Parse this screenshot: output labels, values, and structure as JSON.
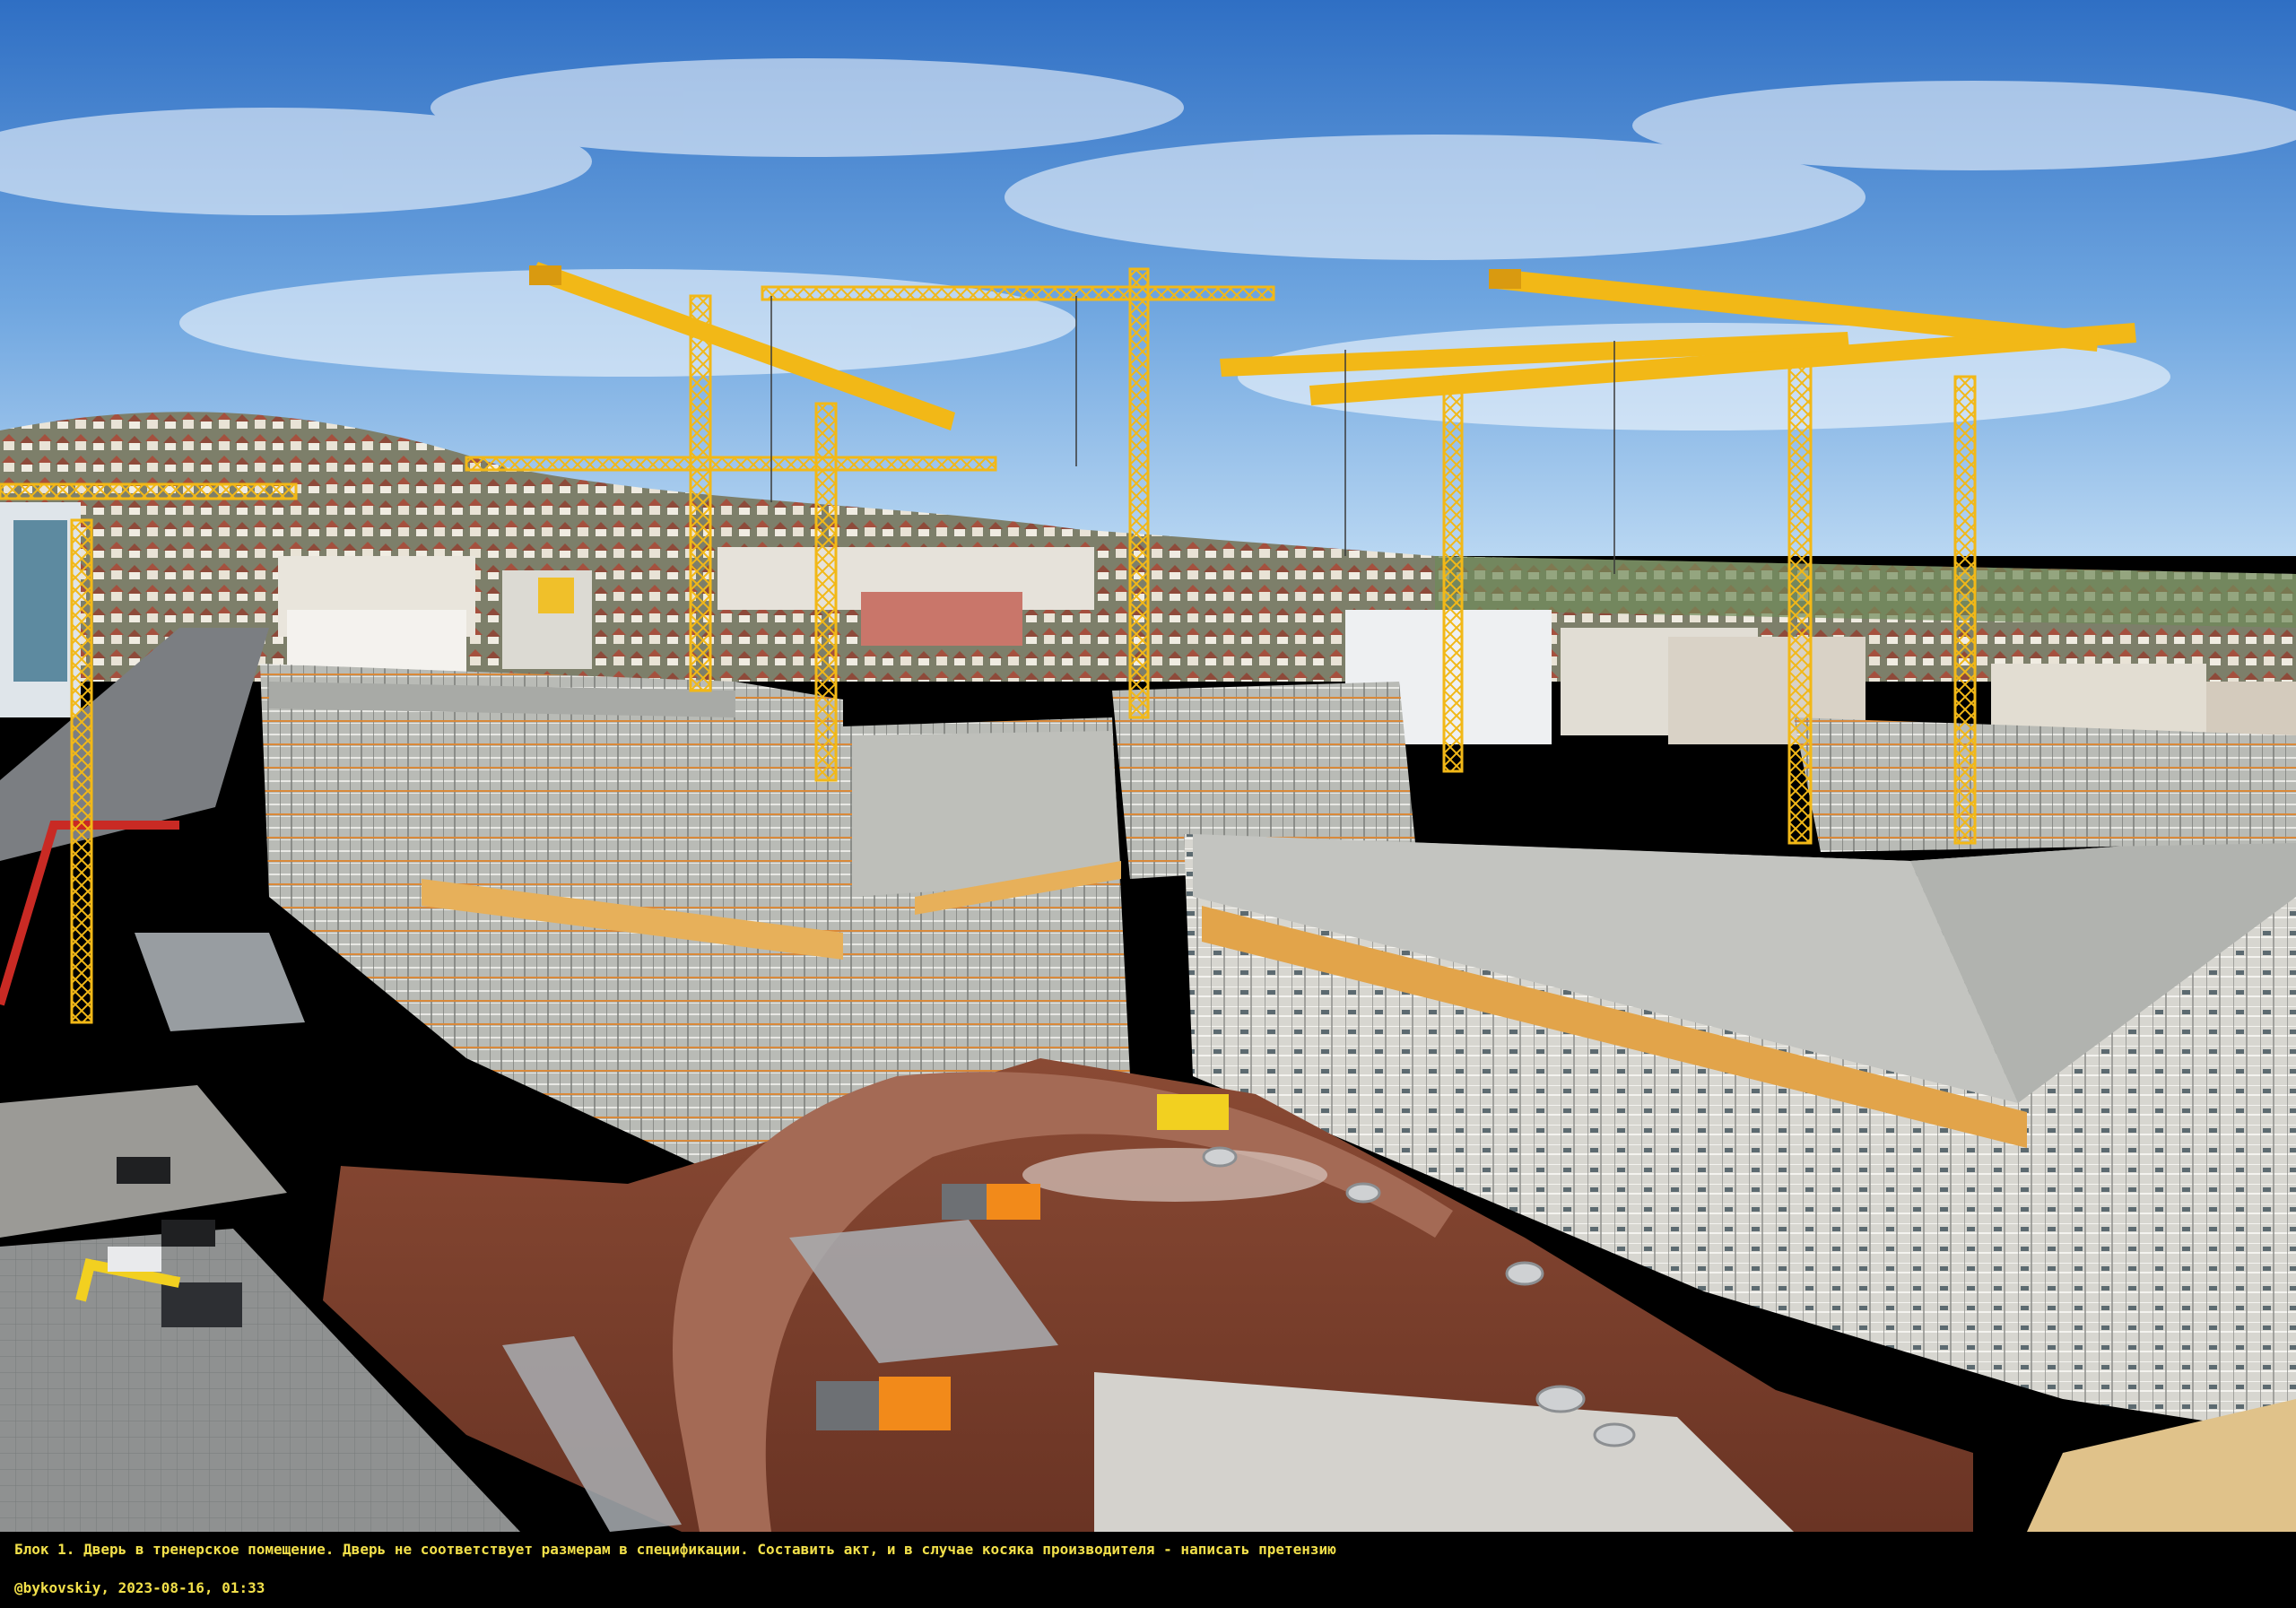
{
  "caption": {
    "note": "Блок 1. Дверь в тренерское помещение. Дверь не соответствует размерам в спецификации. Составить акт, и в случае косяка производителя - написать претензию",
    "author": "@bykovskiy",
    "timestamp": "2023-08-16, 01:33"
  },
  "photo": {
    "subject": "construction-site",
    "colors": {
      "sky_top": "#2f6fc4",
      "sky_horizon": "#a9cdee",
      "crane": "#f2b817",
      "scaffold": "#c7c9c4",
      "soil": "#7a3f2c",
      "plank": "#e7b05a"
    }
  }
}
